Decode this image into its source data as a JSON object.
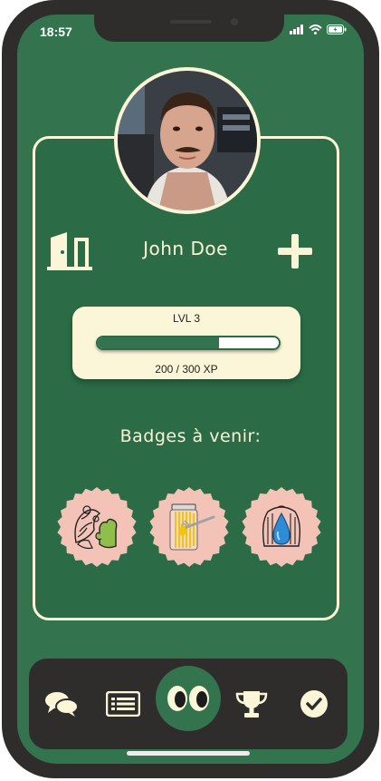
{
  "status_bar": {
    "time": "18:57"
  },
  "profile": {
    "name": "John Doe",
    "level_label": "LVL 3",
    "xp_text": "200 / 300 XP",
    "xp_fraction": 0.67
  },
  "badges": {
    "title": "Badges à venir:",
    "items": [
      "gardening-badge",
      "pasta-jar-badge",
      "water-drop-badge"
    ]
  },
  "tabbar": {
    "items": [
      "chat-icon",
      "list-icon",
      "eyes-icon",
      "trophy-icon",
      "check-icon"
    ],
    "active": "eyes-icon"
  },
  "colors": {
    "background": "#33744e",
    "card": "#2b6b45",
    "cream": "#fbf6d8",
    "badge": "#f2c3b6",
    "dark": "#2f2d2b"
  }
}
